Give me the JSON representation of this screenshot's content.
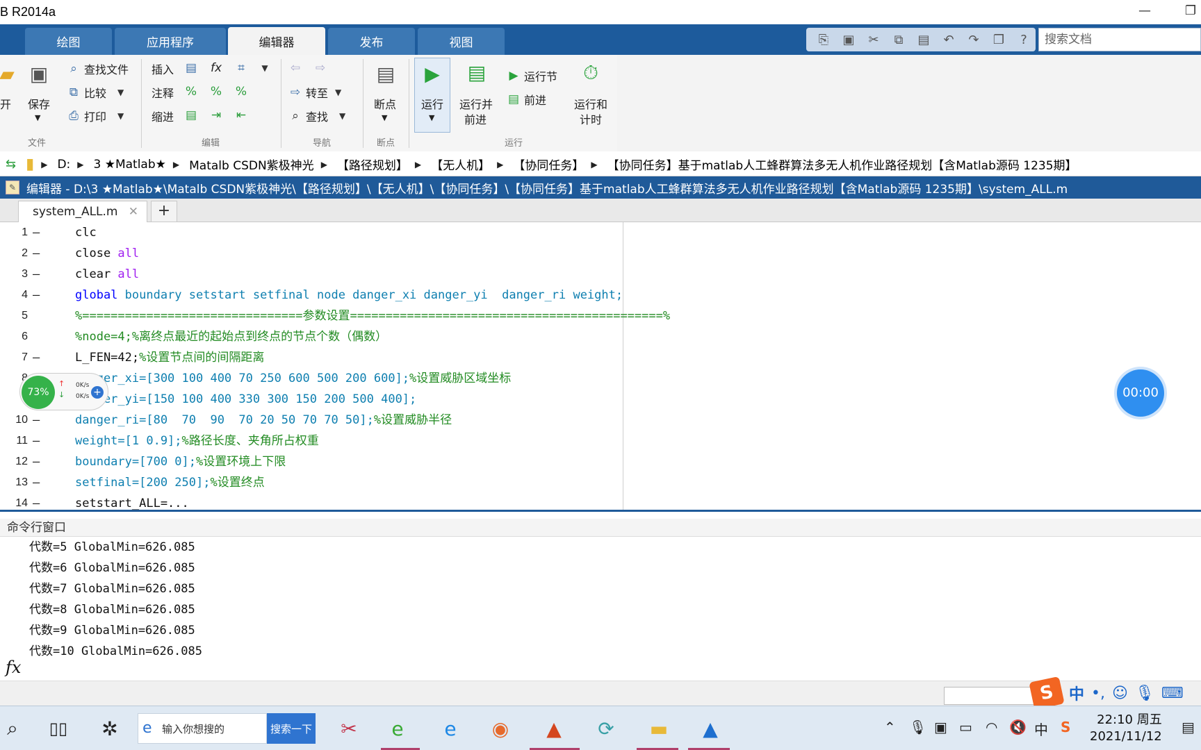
{
  "window": {
    "title": "B R2014a",
    "minimize": "—",
    "restore": "❐"
  },
  "tabs": [
    {
      "label": "绘图"
    },
    {
      "label": "应用程序"
    },
    {
      "label": "编辑器"
    },
    {
      "label": "发布"
    },
    {
      "label": "视图"
    }
  ],
  "search": {
    "placeholder": "搜索文档"
  },
  "ribbon": {
    "file": {
      "open_label": "开",
      "save_label": "保存",
      "find_files": "查找文件",
      "compare": "比较",
      "print": "打印",
      "group": "文件"
    },
    "edit": {
      "insert": "插入",
      "comment": "注释",
      "indent": "缩进",
      "group": "编辑"
    },
    "navigate": {
      "goto": "转至",
      "find": "查找",
      "group": "导航"
    },
    "breakpoints": {
      "label": "断点",
      "group": "断点"
    },
    "run": {
      "run": "运行",
      "run_advance_1": "运行并",
      "run_advance_2": "前进",
      "run_section": "运行节",
      "advance": "前进",
      "run_time_1": "运行和",
      "run_time_2": "计时",
      "group": "运行"
    }
  },
  "address": {
    "crumbs": [
      "D:",
      "3 ★Matlab★",
      "Matalb CSDN紫极神光",
      "【路径规划】",
      "【无人机】",
      "【协同任务】",
      "【协同任务】基于matlab人工蜂群算法多无人机作业路径规划【含Matlab源码 1235期】"
    ]
  },
  "editor": {
    "title": "编辑器 - D:\\3 ★Matlab★\\Matalb CSDN紫极神光\\【路径规划】\\【无人机】\\【协同任务】\\【协同任务】基于matlab人工蜂群算法多无人机作业路径规划【含Matlab源码 1235期】\\system_ALL.m",
    "tab_name": "system_ALL.m",
    "tab_close": "✕",
    "tab_add": "+",
    "lines": [
      {
        "n": "1",
        "dash": "—",
        "a": "clc"
      },
      {
        "n": "2",
        "dash": "—",
        "a": "close ",
        "b": "all"
      },
      {
        "n": "3",
        "dash": "—",
        "a": "clear ",
        "b": "all"
      },
      {
        "n": "4",
        "dash": "—",
        "k": "global",
        "a": " boundary setstart setfinal node danger_xi danger_yi  danger_ri weight;"
      },
      {
        "n": "5",
        "dash": "",
        "c": "%===============================参数设置============================================%"
      },
      {
        "n": "6",
        "dash": "",
        "c": "%node=4;%离终点最近的起始点到终点的节点个数（偶数）"
      },
      {
        "n": "7",
        "dash": "—",
        "a": "L_FEN=42;",
        "c": "%设置节点间的间隔距离"
      },
      {
        "n": "8",
        "dash": "—",
        "a": "danger_xi=[300 100 400 70 250 600 500 200 600];",
        "c": "%设置威胁区域坐标"
      },
      {
        "n": "9",
        "dash": "—",
        "a": "danger_yi=[150 100 400 330 300 150 200 500 400];"
      },
      {
        "n": "10",
        "dash": "—",
        "a": "danger_ri=[80  70  90  70 20 50 70 70 50];",
        "c": "%设置威胁半径"
      },
      {
        "n": "11",
        "dash": "—",
        "a": "weight=[1 0.9];",
        "c": "%路径长度、夹角所占权重"
      },
      {
        "n": "12",
        "dash": "—",
        "a": "boundary=[700 0];",
        "c": "%设置环境上下限"
      },
      {
        "n": "13",
        "dash": "—",
        "a": "setfinal=[200 250];",
        "c": "%设置终点"
      },
      {
        "n": "14",
        "dash": "—",
        "a": "setstart_ALL=..."
      }
    ]
  },
  "net_widget": {
    "percent": "73%",
    "up": "0K/s",
    "down": "0K/s",
    "plus": "+"
  },
  "timer": {
    "value": "00:00"
  },
  "command": {
    "title": "命令行窗口",
    "lines": [
      "代数=5 GlobalMin=626.085",
      "代数=6 GlobalMin=626.085",
      "代数=7 GlobalMin=626.085",
      "代数=8 GlobalMin=626.085",
      "代数=9 GlobalMin=626.085",
      "代数=10 GlobalMin=626.085"
    ],
    "prompt": "fx"
  },
  "ime": {
    "logo": "S",
    "lang": "中"
  },
  "taskbar": {
    "search_text": "输入你想搜的",
    "search_button": "搜索一下",
    "tray_lang": "中",
    "time": "22:10 周五",
    "date": "2021/11/12"
  }
}
